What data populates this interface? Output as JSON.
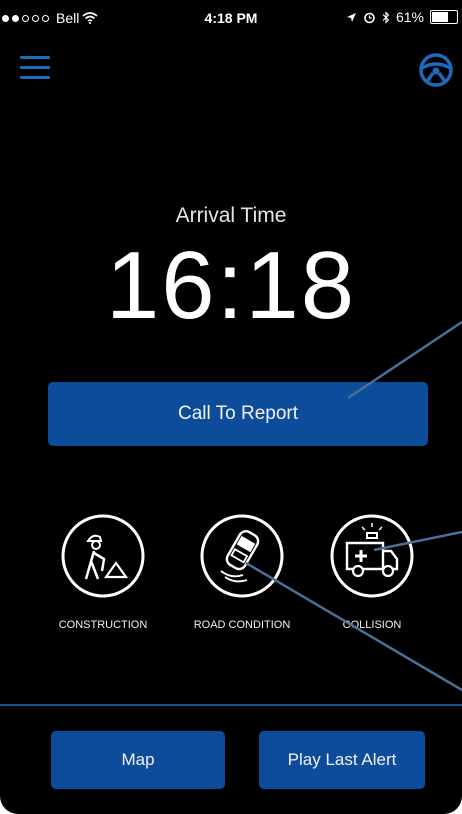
{
  "status_bar": {
    "carrier": "Bell",
    "time": "4:18 PM",
    "battery": "61%",
    "battery_level": 0.61
  },
  "header": {
    "menu_icon": "hamburger-menu-icon",
    "steering_icon": "steering-wheel-icon"
  },
  "arrival": {
    "label": "Arrival Time",
    "time": "16:18"
  },
  "report_button": {
    "label": "Call To Report"
  },
  "categories": [
    {
      "label": "CONSTRUCTION",
      "icon": "construction-worker-icon"
    },
    {
      "label": "ROAD CONDITION",
      "icon": "skidding-car-icon"
    },
    {
      "label": "COLLISION",
      "icon": "ambulance-icon"
    }
  ],
  "footer": {
    "map_label": "Map",
    "play_label": "Play Last Alert"
  },
  "colors": {
    "background": "#000000",
    "accent": "#0d4c9a",
    "icon_blue": "#1e6bbd",
    "pointer": "#4a6f98"
  }
}
